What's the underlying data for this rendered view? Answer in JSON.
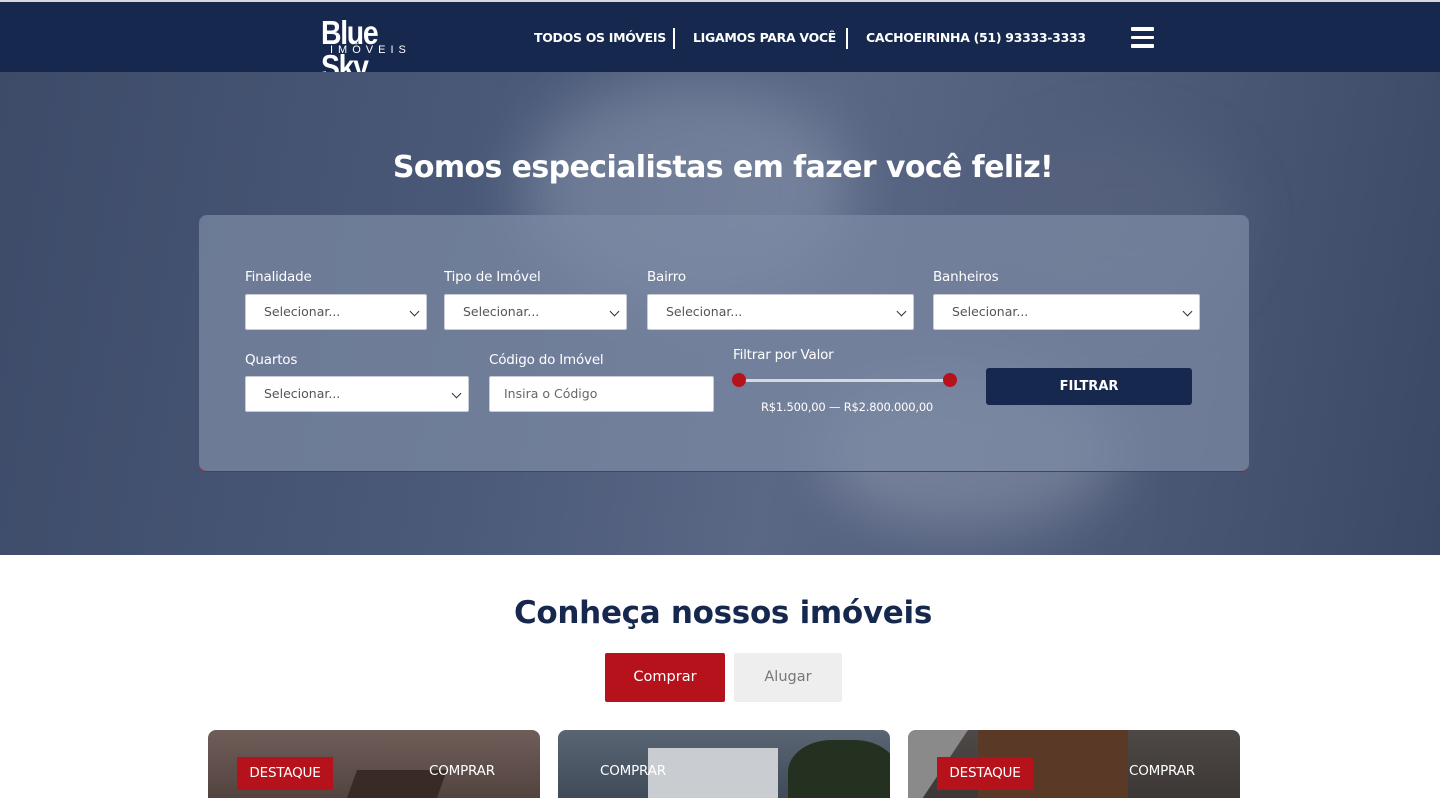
{
  "header": {
    "logo_main": "Blue Sky",
    "logo_sub": "IMÓVEIS",
    "nav": {
      "all_properties": "TODOS OS IMÓVEIS",
      "call_you": "LIGAMOS PARA VOCÊ",
      "phone": "CACHOEIRINHA (51) 93333-3333"
    }
  },
  "hero": {
    "title": "Somos especialistas em fazer você feliz!"
  },
  "search": {
    "finalidade": {
      "label": "Finalidade",
      "value": "Selecionar..."
    },
    "tipo": {
      "label": "Tipo de Imóvel",
      "value": "Selecionar..."
    },
    "bairro": {
      "label": "Bairro",
      "value": "Selecionar..."
    },
    "banheiros": {
      "label": "Banheiros",
      "value": "Selecionar..."
    },
    "quartos": {
      "label": "Quartos",
      "value": "Selecionar..."
    },
    "codigo": {
      "label": "Código do Imóvel",
      "placeholder": "Insira o Código"
    },
    "valor": {
      "label": "Filtrar por Valor",
      "range_text": "R$1.500,00 — R$2.800.000,00"
    },
    "filter_button": "FILTRAR"
  },
  "properties": {
    "title": "Conheça nossos imóveis",
    "tabs": {
      "buy": "Comprar",
      "rent": "Alugar",
      "active": "buy"
    },
    "cards": [
      {
        "featured": "DESTAQUE",
        "type": "COMPRAR"
      },
      {
        "featured": "",
        "type": "COMPRAR"
      },
      {
        "featured": "DESTAQUE",
        "type": "COMPRAR"
      }
    ]
  },
  "colors": {
    "navy": "#16284e",
    "accent_red": "#b5121b"
  },
  "icons": [
    "menu-icon",
    "chevron-down-icon"
  ]
}
